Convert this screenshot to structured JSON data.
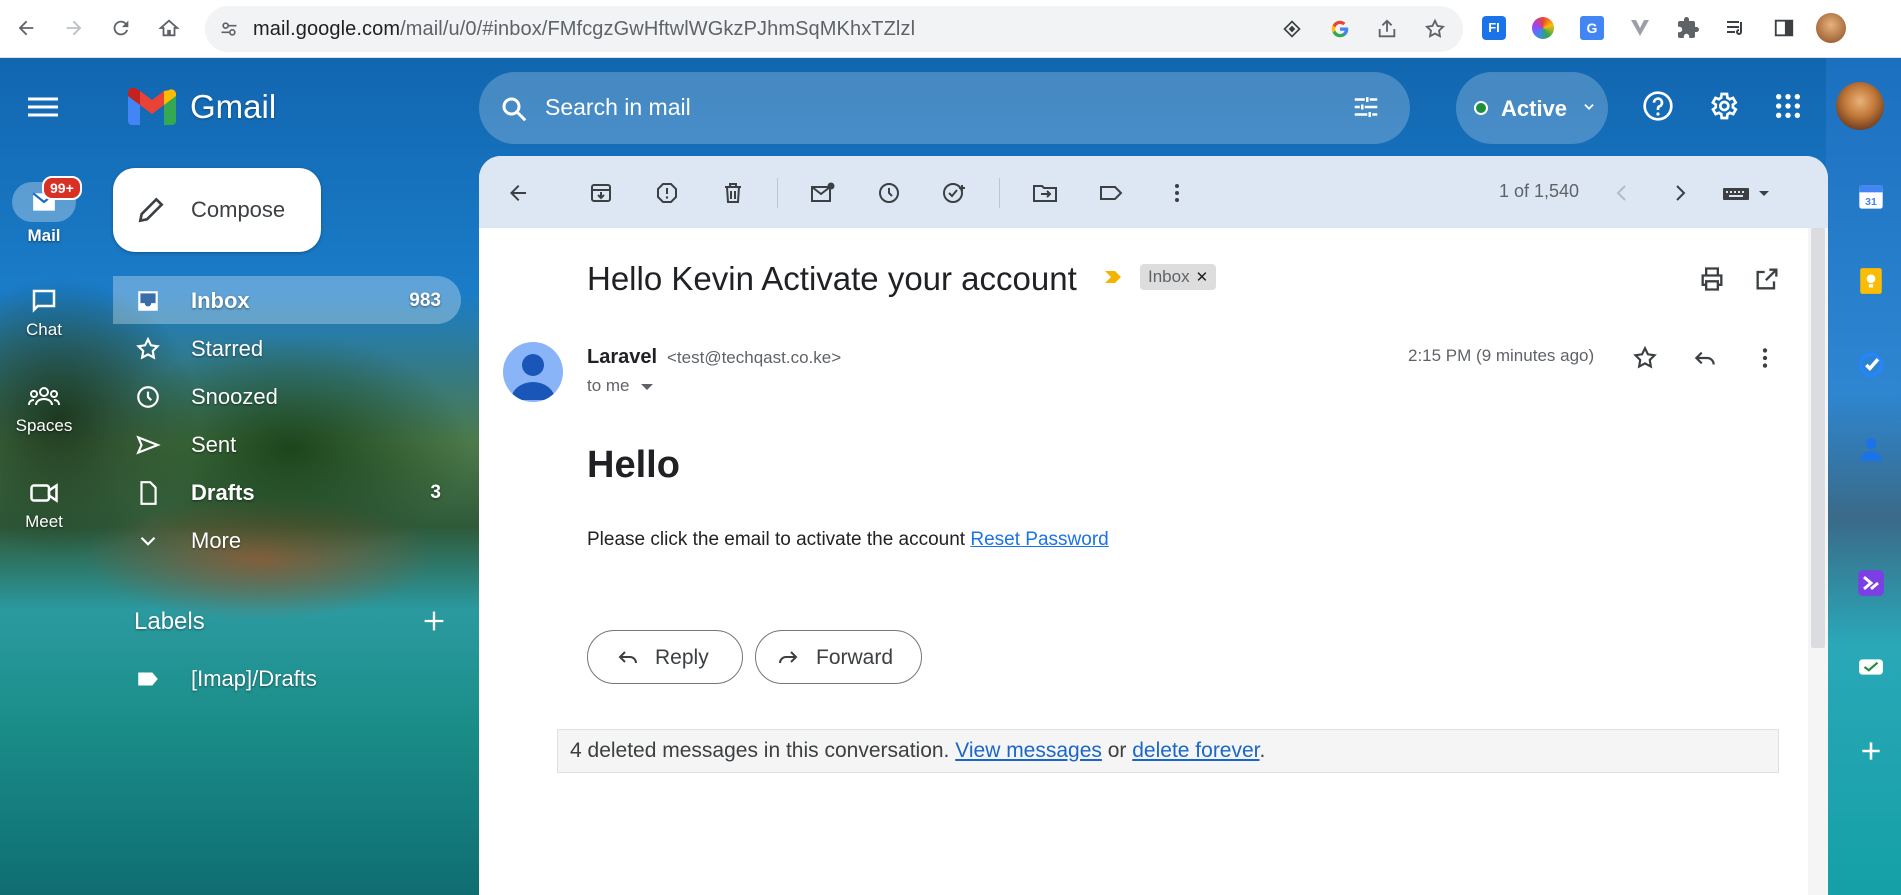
{
  "browser": {
    "url_host": "mail.google.com",
    "url_path": "/mail/u/0/#inbox/FMfcgzGwHftwlWGkzPJhmSqMKhxTZlzl"
  },
  "rail": {
    "badge": "99+",
    "items": [
      {
        "label": "Mail"
      },
      {
        "label": "Chat"
      },
      {
        "label": "Spaces"
      },
      {
        "label": "Meet"
      }
    ]
  },
  "header": {
    "logo": "Gmail",
    "search_placeholder": "Search in mail",
    "status": "Active",
    "status_color": "#1e8e3e"
  },
  "compose_label": "Compose",
  "nav": [
    {
      "label": "Inbox",
      "count": "983",
      "icon": "inbox-icon"
    },
    {
      "label": "Starred",
      "count": "",
      "icon": "star-icon"
    },
    {
      "label": "Snoozed",
      "count": "",
      "icon": "clock-icon"
    },
    {
      "label": "Sent",
      "count": "",
      "icon": "send-icon"
    },
    {
      "label": "Drafts",
      "count": "3",
      "icon": "draft-icon"
    },
    {
      "label": "More",
      "count": "",
      "icon": "chevron-down-icon"
    }
  ],
  "labels": {
    "title": "Labels",
    "items": [
      {
        "label": "[Imap]/Drafts"
      }
    ]
  },
  "toolbar": {
    "pager": "1 of 1,540"
  },
  "message": {
    "subject": "Hello Kevin Activate your account",
    "label_chip": "Inbox",
    "sender_name": "Laravel",
    "sender_email": "<test@techqast.co.ke>",
    "recipient": "to me",
    "time": "2:15 PM (9 minutes ago)",
    "heading": "Hello",
    "body": "Please click the email to activate the account ",
    "link_text": "Reset Password"
  },
  "actions": {
    "reply": "Reply",
    "forward": "Forward"
  },
  "deleted_notice": {
    "text": "4 deleted messages in this conversation. ",
    "view_link": "View messages",
    "or": " or ",
    "delete_link": "delete forever",
    "end": "."
  },
  "colors": {
    "accent": "#1a73e8",
    "toolbar_bg": "#dce7f3"
  }
}
